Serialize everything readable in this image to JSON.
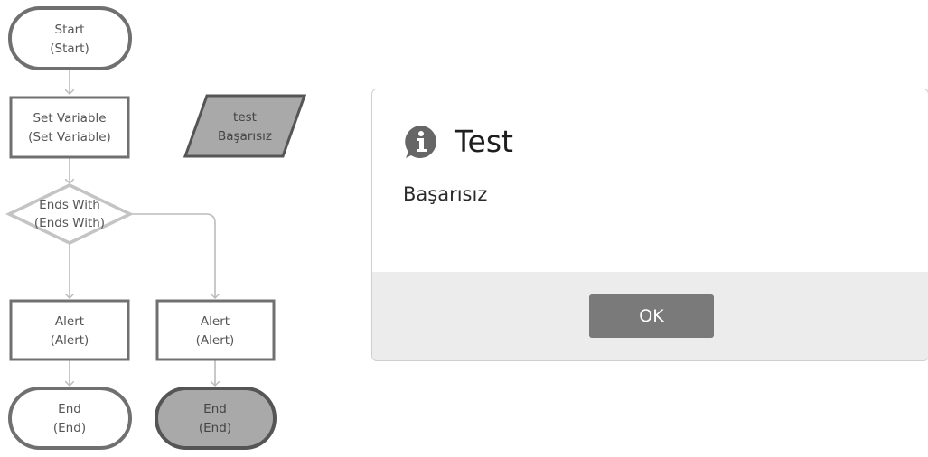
{
  "flowchart": {
    "start": {
      "label": "Start",
      "sub": "(Start)"
    },
    "set_variable": {
      "label": "Set Variable",
      "sub": "(Set Variable)"
    },
    "output": {
      "label": "test",
      "sub": "Başarısız"
    },
    "ends_with": {
      "label": "Ends With",
      "sub": "(Ends With)"
    },
    "alert_left": {
      "label": "Alert",
      "sub": "(Alert)"
    },
    "alert_right": {
      "label": "Alert",
      "sub": "(Alert)"
    },
    "end_left": {
      "label": "End",
      "sub": "(End)"
    },
    "end_right": {
      "label": "End",
      "sub": "(End)"
    }
  },
  "dialog": {
    "title": "Test",
    "icon": "info-icon",
    "message": "Başarısız",
    "ok_label": "OK"
  },
  "colors": {
    "node_border": "#707070",
    "node_fill": "#ffffff",
    "highlight_fill": "#a9a9a9",
    "connector": "#bbbbbb",
    "decision_border": "#c4c4c4",
    "dialog_footer": "#ececec",
    "button": "#7a7a7a"
  }
}
